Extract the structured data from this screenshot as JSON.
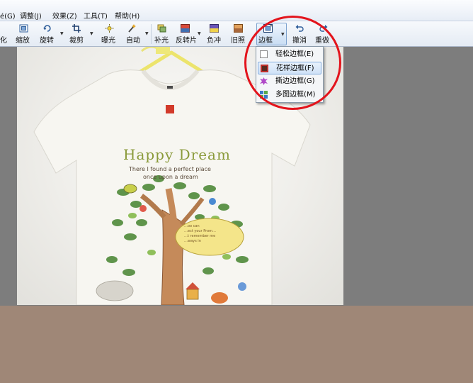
{
  "menu": {
    "items": [
      {
        "label": "调整",
        "key": "(J)"
      },
      {
        "label": "效果",
        "key": "(Z)"
      },
      {
        "label": "工具",
        "key": "(T)"
      },
      {
        "label": "帮助",
        "key": "(H)"
      }
    ],
    "partial_left": "é(G)"
  },
  "toolbar": {
    "partial_left": "化",
    "buttons": [
      {
        "label": "缩放",
        "icon": "resize-icon"
      },
      {
        "label": "旋转",
        "icon": "rotate-icon"
      },
      {
        "label": "裁剪",
        "icon": "crop-icon"
      },
      {
        "label": "曝光",
        "icon": "exposure-icon"
      },
      {
        "label": "自动",
        "icon": "auto-wand-icon"
      },
      {
        "label": "补光",
        "icon": "fill-light-icon"
      },
      {
        "label": "反转片",
        "icon": "reversal-film-icon"
      },
      {
        "label": "负冲",
        "icon": "negative-icon"
      },
      {
        "label": "旧照",
        "icon": "old-photo-icon"
      },
      {
        "label": "边框",
        "icon": "border-frame-icon"
      },
      {
        "label": "撤消",
        "icon": "undo-icon"
      },
      {
        "label": "重做",
        "icon": "redo-icon"
      }
    ]
  },
  "dropdown": {
    "items": [
      {
        "label": "轻松边框(E)",
        "icon": "simple-frame-icon"
      },
      {
        "label": "花样边框(F)",
        "icon": "fancy-frame-icon",
        "highlighted": true
      },
      {
        "label": "撕边边框(G)",
        "icon": "torn-edge-icon"
      },
      {
        "label": "多图边框(M)",
        "icon": "multi-image-icon"
      }
    ]
  },
  "photo": {
    "shirt_title": "Happy Dream",
    "shirt_line1": "There I found a perfect place",
    "shirt_line2": "once upon a dream",
    "bubble_text": [
      "…oo can",
      "…ect your Prom…",
      "…t remember me",
      "…ways in"
    ]
  },
  "colors": {
    "highlight_ring": "#e3141c",
    "canvas_bg": "#7d7d7d",
    "bottom_band": "#9f8777"
  }
}
